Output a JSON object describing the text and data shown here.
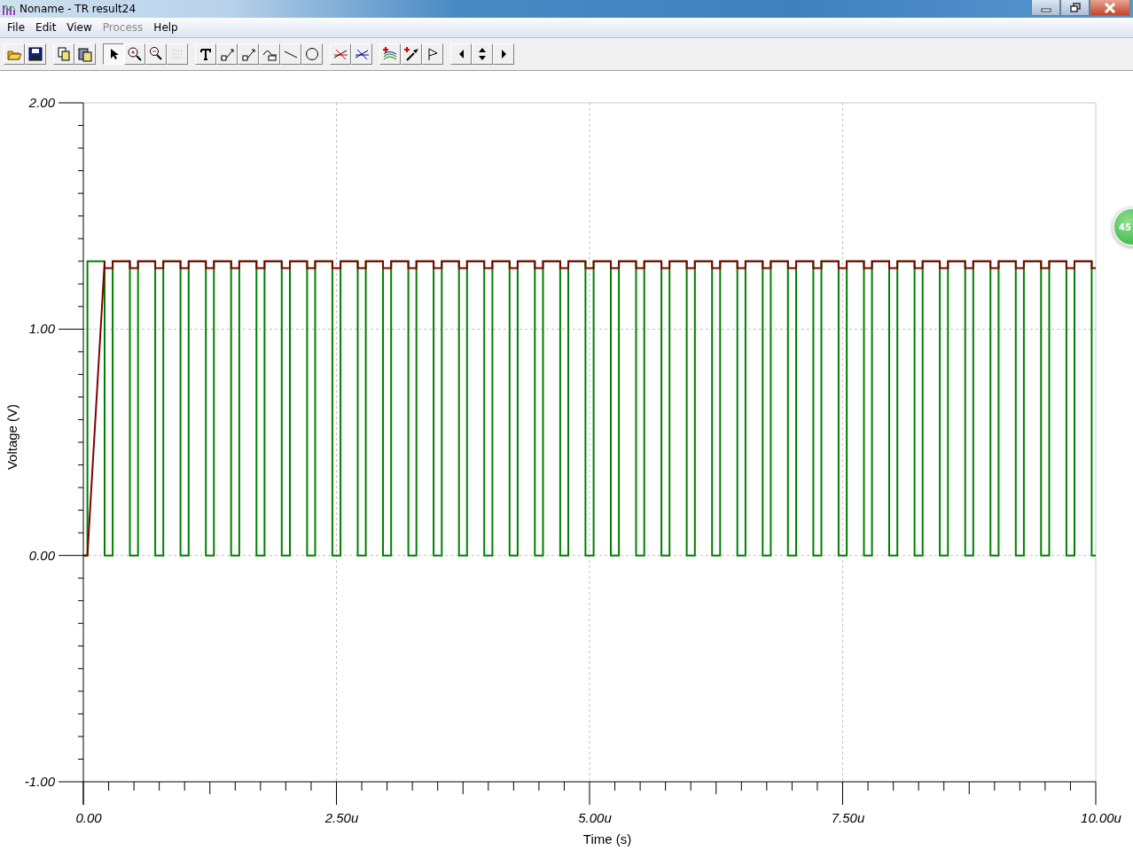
{
  "window": {
    "title": "Noname - TR result24"
  },
  "menu": [
    {
      "label": "File",
      "disabled": false
    },
    {
      "label": "Edit",
      "disabled": false
    },
    {
      "label": "View",
      "disabled": false
    },
    {
      "label": "Process",
      "disabled": true
    },
    {
      "label": "Help",
      "disabled": false
    }
  ],
  "toolbar": [
    [
      {
        "kind": "open",
        "selected": false
      },
      {
        "kind": "save",
        "selected": false
      }
    ],
    [
      {
        "kind": "copy",
        "selected": false
      },
      {
        "kind": "paste",
        "selected": false
      }
    ],
    [
      {
        "kind": "pointer",
        "selected": true
      },
      {
        "kind": "zoom-in",
        "selected": false
      },
      {
        "kind": "zoom-out",
        "selected": false
      },
      {
        "kind": "grid",
        "selected": false
      }
    ],
    [
      {
        "kind": "text",
        "selected": false
      },
      {
        "kind": "tag",
        "selected": false
      },
      {
        "kind": "tag",
        "selected": false
      },
      {
        "kind": "curve-tag",
        "selected": false
      },
      {
        "kind": "line",
        "selected": false
      },
      {
        "kind": "circle",
        "selected": false
      }
    ],
    [
      {
        "kind": "cursor-a",
        "selected": false
      },
      {
        "kind": "cursor-b",
        "selected": false
      }
    ],
    [
      {
        "kind": "add-trace",
        "selected": false
      },
      {
        "kind": "probe",
        "selected": false
      },
      {
        "kind": "flag",
        "selected": false
      }
    ],
    [
      {
        "kind": "left",
        "selected": false
      },
      {
        "kind": "updown",
        "selected": false
      },
      {
        "kind": "right",
        "selected": false
      }
    ]
  ],
  "chart": {
    "chart_data": {
      "type": "line",
      "xlabel": "Time (s)",
      "ylabel": "Voltage (V)",
      "grid": true,
      "xlim": [
        0,
        10
      ],
      "ylim": [
        -1,
        2
      ],
      "xticks": [
        {
          "value": 0,
          "label": "0.00"
        },
        {
          "value": 2.5,
          "label": "2.50u"
        },
        {
          "value": 5,
          "label": "5.00u"
        },
        {
          "value": 7.5,
          "label": "7.50u"
        },
        {
          "value": 10,
          "label": "10.00u"
        }
      ],
      "yticks": [
        {
          "value": -1,
          "label": "-1.00"
        },
        {
          "value": 0,
          "label": "0.00"
        },
        {
          "value": 1,
          "label": "1.00"
        },
        {
          "value": 2,
          "label": "2.00"
        }
      ],
      "x": [
        0,
        0.04,
        0.04,
        0.21,
        0.21,
        0.29,
        0.29,
        0.46,
        0.46,
        0.54,
        0.54,
        0.71,
        0.71,
        0.79,
        0.79,
        0.96,
        0.96,
        1.04,
        1.04,
        1.21,
        1.21,
        1.29,
        1.29,
        1.46,
        1.46,
        1.54,
        1.54,
        1.71,
        1.71,
        1.79,
        1.79,
        1.96,
        1.96,
        2.04,
        2.04,
        2.21,
        2.21,
        2.29,
        2.29,
        2.46,
        2.46,
        2.54,
        2.54,
        2.71,
        2.71,
        2.79,
        2.79,
        2.96,
        2.96,
        3.04,
        3.04,
        3.21,
        3.21,
        3.29,
        3.29,
        3.46,
        3.46,
        3.54,
        3.54,
        3.71,
        3.71,
        3.79,
        3.79,
        3.96,
        3.96,
        4.04,
        4.04,
        4.21,
        4.21,
        4.29,
        4.29,
        4.46,
        4.46,
        4.54,
        4.54,
        4.71,
        4.71,
        4.79,
        4.79,
        4.96,
        4.96,
        5.04,
        5.04,
        5.21,
        5.21,
        5.29,
        5.29,
        5.46,
        5.46,
        5.54,
        5.54,
        5.71,
        5.71,
        5.79,
        5.79,
        5.96,
        5.96,
        6.04,
        6.04,
        6.21,
        6.21,
        6.29,
        6.29,
        6.46,
        6.46,
        6.54,
        6.54,
        6.71,
        6.71,
        6.79,
        6.79,
        6.96,
        6.96,
        7.04,
        7.04,
        7.21,
        7.21,
        7.29,
        7.29,
        7.46,
        7.46,
        7.54,
        7.54,
        7.71,
        7.71,
        7.79,
        7.79,
        7.96,
        7.96,
        8.04,
        8.04,
        8.21,
        8.21,
        8.29,
        8.29,
        8.46,
        8.46,
        8.54,
        8.54,
        8.71,
        8.71,
        8.79,
        8.79,
        8.96,
        8.96,
        9.04,
        9.04,
        9.21,
        9.21,
        9.29,
        9.29,
        9.46,
        9.46,
        9.54,
        9.54,
        9.71,
        9.71,
        9.79,
        9.79,
        9.96,
        9.96,
        10
      ],
      "series": [
        {
          "color": "#008000",
          "values": [
            0,
            0,
            1.3,
            1.3,
            0,
            0,
            1.3,
            1.3,
            0,
            0,
            1.3,
            1.3,
            0,
            0,
            1.3,
            1.3,
            0,
            0,
            1.3,
            1.3,
            0,
            0,
            1.3,
            1.3,
            0,
            0,
            1.3,
            1.3,
            0,
            0,
            1.3,
            1.3,
            0,
            0,
            1.3,
            1.3,
            0,
            0,
            1.3,
            1.3,
            0,
            0,
            1.3,
            1.3,
            0,
            0,
            1.3,
            1.3,
            0,
            0,
            1.3,
            1.3,
            0,
            0,
            1.3,
            1.3,
            0,
            0,
            1.3,
            1.3,
            0,
            0,
            1.3,
            1.3,
            0,
            0,
            1.3,
            1.3,
            0,
            0,
            1.3,
            1.3,
            0,
            0,
            1.3,
            1.3,
            0,
            0,
            1.3,
            1.3,
            0,
            0,
            1.3,
            1.3,
            0,
            0,
            1.3,
            1.3,
            0,
            0,
            1.3,
            1.3,
            0,
            0,
            1.3,
            1.3,
            0,
            0,
            1.3,
            1.3,
            0,
            0,
            1.3,
            1.3,
            0,
            0,
            1.3,
            1.3,
            0,
            0,
            1.3,
            1.3,
            0,
            0,
            1.3,
            1.3,
            0,
            0,
            1.3,
            1.3,
            0,
            0,
            1.3,
            1.3,
            0,
            0,
            1.3,
            1.3,
            0,
            0,
            1.3,
            1.3,
            0,
            0,
            1.3,
            1.3,
            0,
            0,
            1.3,
            1.3,
            0,
            0,
            1.3,
            1.3,
            0,
            0,
            1.3,
            1.3,
            0,
            0,
            1.3,
            1.3,
            0,
            0,
            1.3,
            1.3,
            0,
            0,
            1.3,
            1.3,
            0,
            0
          ]
        },
        {
          "color": "#800000",
          "values": [
            0,
            0,
            0,
            1.3,
            1.27,
            1.27,
            1.3,
            1.3,
            1.27,
            1.27,
            1.3,
            1.3,
            1.27,
            1.27,
            1.3,
            1.3,
            1.27,
            1.27,
            1.3,
            1.3,
            1.27,
            1.27,
            1.3,
            1.3,
            1.27,
            1.27,
            1.3,
            1.3,
            1.27,
            1.27,
            1.3,
            1.3,
            1.27,
            1.27,
            1.3,
            1.3,
            1.27,
            1.27,
            1.3,
            1.3,
            1.27,
            1.27,
            1.3,
            1.3,
            1.27,
            1.27,
            1.3,
            1.3,
            1.27,
            1.27,
            1.3,
            1.3,
            1.27,
            1.27,
            1.3,
            1.3,
            1.27,
            1.27,
            1.3,
            1.3,
            1.27,
            1.27,
            1.3,
            1.3,
            1.27,
            1.27,
            1.3,
            1.3,
            1.27,
            1.27,
            1.3,
            1.3,
            1.27,
            1.27,
            1.3,
            1.3,
            1.27,
            1.27,
            1.3,
            1.3,
            1.27,
            1.27,
            1.3,
            1.3,
            1.27,
            1.27,
            1.3,
            1.3,
            1.27,
            1.27,
            1.3,
            1.3,
            1.27,
            1.27,
            1.3,
            1.3,
            1.27,
            1.27,
            1.3,
            1.3,
            1.27,
            1.27,
            1.3,
            1.3,
            1.27,
            1.27,
            1.3,
            1.3,
            1.27,
            1.27,
            1.3,
            1.3,
            1.27,
            1.27,
            1.3,
            1.3,
            1.27,
            1.27,
            1.3,
            1.3,
            1.27,
            1.27,
            1.3,
            1.3,
            1.27,
            1.27,
            1.3,
            1.3,
            1.27,
            1.27,
            1.3,
            1.3,
            1.27,
            1.27,
            1.3,
            1.3,
            1.27,
            1.27,
            1.3,
            1.3,
            1.27,
            1.27,
            1.3,
            1.3,
            1.27,
            1.27,
            1.3,
            1.3,
            1.27,
            1.27,
            1.3,
            1.3,
            1.27,
            1.27,
            1.3,
            1.3,
            1.27,
            1.27,
            1.3,
            1.3,
            1.27,
            1.27
          ]
        }
      ]
    }
  },
  "floating_badge": {
    "text": "45"
  }
}
